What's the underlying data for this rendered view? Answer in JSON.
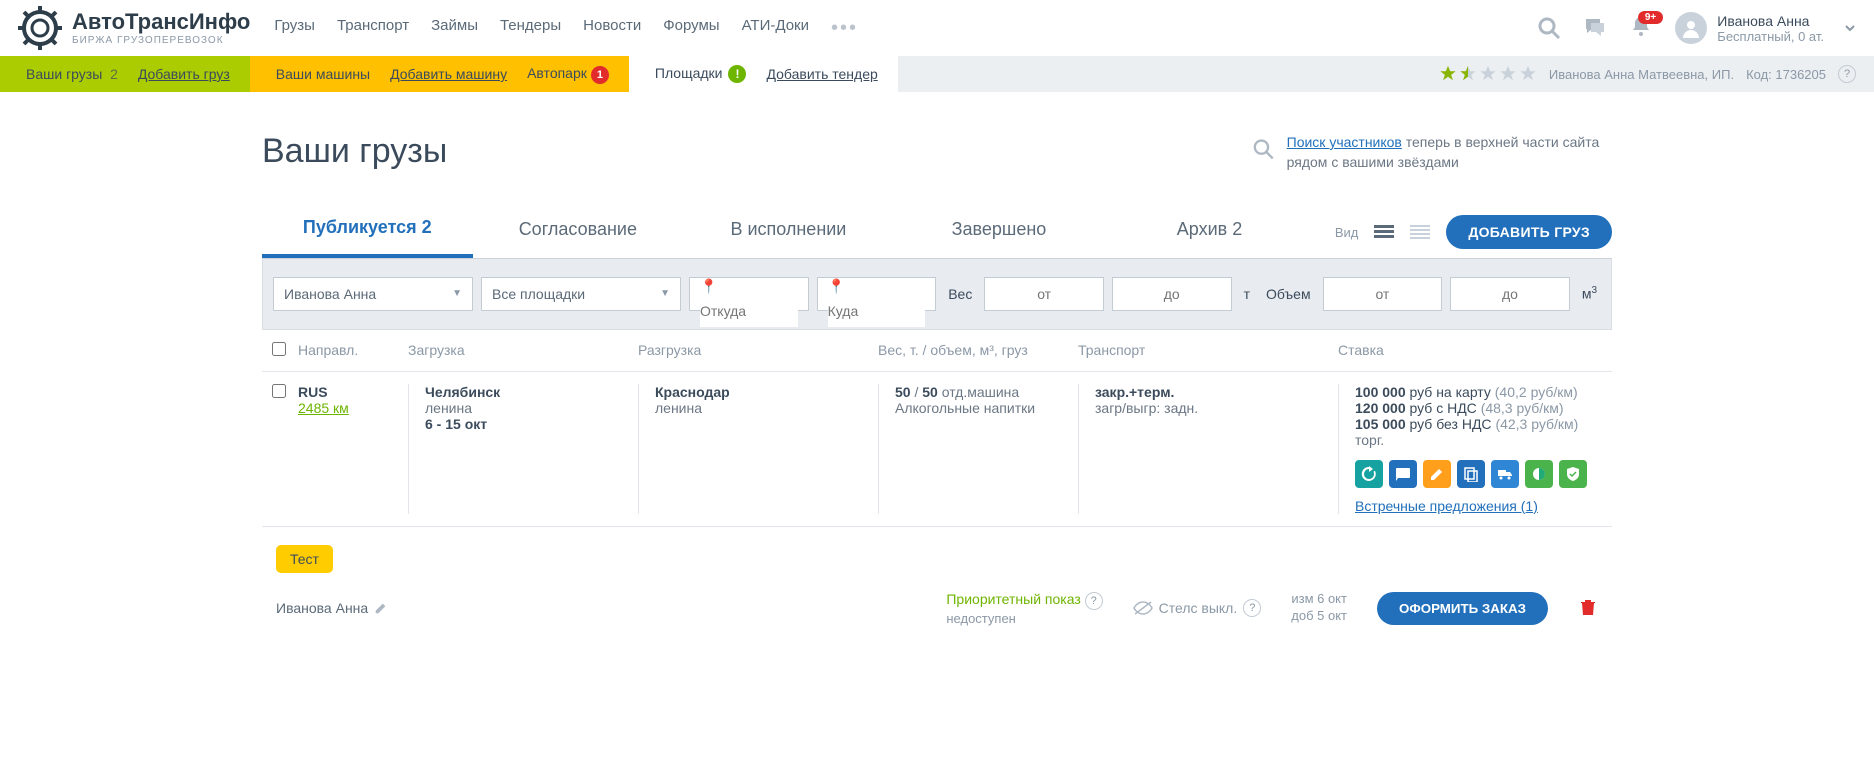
{
  "brand": {
    "name": "АвтоТрансИнфо",
    "sub": "БИРЖА ГРУЗОПЕРЕВОЗОК"
  },
  "nav": [
    "Грузы",
    "Транспорт",
    "Займы",
    "Тендеры",
    "Новости",
    "Форумы",
    "АТИ-Доки"
  ],
  "notif_badge": "9+",
  "user": {
    "name": "Иванова Анна",
    "plan": "Бесплатный, 0 ат."
  },
  "subbar": {
    "green": {
      "label": "Ваши грузы",
      "count": "2",
      "add": "Добавить груз"
    },
    "yellow": {
      "label": "Ваши машины",
      "add": "Добавить машину",
      "park": "Автопарк",
      "park_badge": "1"
    },
    "white": {
      "label": "Площадки",
      "exc": "!",
      "add": "Добавить тендер"
    },
    "tail": {
      "owner": "Иванова Анна Матвеевна, ИП.",
      "code": "Код: 1736205"
    }
  },
  "page_title": "Ваши грузы",
  "hint": {
    "link": "Поиск участников",
    "rest": " теперь в верхней части сайта рядом с вашими звёздами"
  },
  "tabs": [
    {
      "label": "Публикуется 2",
      "active": true
    },
    {
      "label": "Согласование"
    },
    {
      "label": "В исполнении"
    },
    {
      "label": "Завершено"
    },
    {
      "label": "Архив 2"
    }
  ],
  "view_label": "Вид",
  "add_cargo": "ДОБАВИТЬ ГРУЗ",
  "filters": {
    "user": "Иванова Анна",
    "platform": "Все площадки",
    "from_ph": "Откуда",
    "to_ph": "Куда",
    "weight": "Вес",
    "from": "от",
    "to": "до",
    "t": "т",
    "volume": "Объем",
    "m3": "м³"
  },
  "thead": {
    "dir": "Направл.",
    "load": "Загрузка",
    "unload": "Разгрузка",
    "weight": "Вес, т. / объем, м³, груз",
    "trans": "Транспорт",
    "rate": "Ставка"
  },
  "row": {
    "country": "RUS",
    "km": "2485 км",
    "load_city": "Челябинск",
    "load_addr": "ленина",
    "load_date": "6 - 15 окт",
    "unload_city": "Краснодар",
    "unload_addr": "ленина",
    "weight": {
      "a": "50",
      "sep": " / ",
      "b": "50",
      "unit": " отд.машина",
      "cargo": "Алкогольные напитки"
    },
    "trans": {
      "l1": "закр.+терм.",
      "l2": "загр/выгр: задн."
    },
    "rate": {
      "l1a": "100 000",
      "l1b": " руб на карту ",
      "l1c": "(40,2 руб/км)",
      "l2a": "120 000",
      "l2b": " руб с НДС ",
      "l2c": "(48,3 руб/км)",
      "l3a": "105 000",
      "l3b": " руб без НДС ",
      "l3c": "(42,3 руб/км)",
      "l4": "торг."
    },
    "counter": "Встречные предложения (1)"
  },
  "test": "Тест",
  "foot": {
    "owner": "Иванова Анна",
    "priority1": "Приоритетный показ",
    "priority2": "недоступен",
    "stealth": "Стелс выкл.",
    "date1": "изм 6 окт",
    "date2": "доб 5 окт",
    "order": "ОФОРМИТЬ ЗАКАЗ"
  }
}
